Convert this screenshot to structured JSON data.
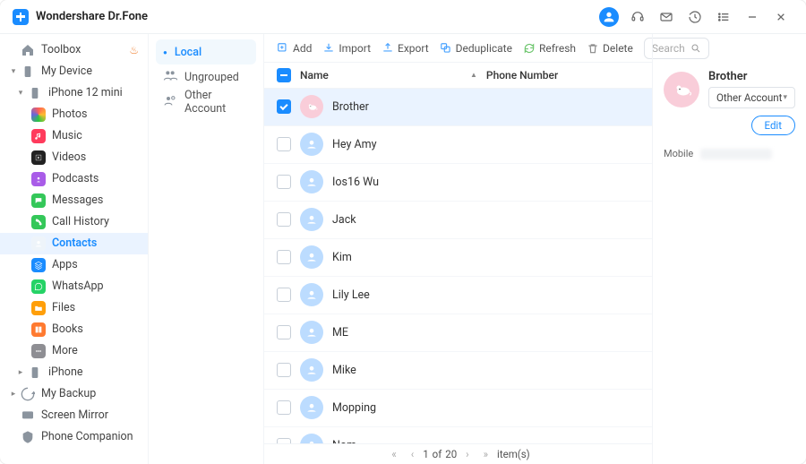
{
  "app": {
    "title": "Wondershare Dr.Fone"
  },
  "sidebar": {
    "toolbox": "Toolbox",
    "my_device": "My Device",
    "device_name": "iPhone 12 mini",
    "items": [
      {
        "label": "Photos"
      },
      {
        "label": "Music"
      },
      {
        "label": "Videos"
      },
      {
        "label": "Podcasts"
      },
      {
        "label": "Messages"
      },
      {
        "label": "Call History"
      },
      {
        "label": "Contacts"
      },
      {
        "label": "Apps"
      },
      {
        "label": "WhatsApp"
      },
      {
        "label": "Files"
      },
      {
        "label": "Books"
      },
      {
        "label": "More"
      }
    ],
    "iphone": "iPhone",
    "my_backup": "My Backup",
    "screen_mirror": "Screen Mirror",
    "phone_companion": "Phone Companion"
  },
  "categories": {
    "local": "Local",
    "ungrouped": "Ungrouped",
    "other_account": "Other Account"
  },
  "toolbar": {
    "add": "Add",
    "import": "Import",
    "export": "Export",
    "deduplicate": "Deduplicate",
    "refresh": "Refresh",
    "delete": "Delete",
    "search_placeholder": "Search"
  },
  "table": {
    "col_name": "Name",
    "col_phone": "Phone Number",
    "rows": [
      {
        "name": "Brother",
        "selected": true,
        "avatar": "pink"
      },
      {
        "name": "Hey  Amy",
        "selected": false,
        "avatar": "blue"
      },
      {
        "name": "Ios16  Wu",
        "selected": false,
        "avatar": "blue"
      },
      {
        "name": "Jack",
        "selected": false,
        "avatar": "blue"
      },
      {
        "name": "Kim",
        "selected": false,
        "avatar": "blue"
      },
      {
        "name": "Lily  Lee",
        "selected": false,
        "avatar": "blue"
      },
      {
        "name": "ME",
        "selected": false,
        "avatar": "blue"
      },
      {
        "name": "Mike",
        "selected": false,
        "avatar": "blue"
      },
      {
        "name": "Mopping",
        "selected": false,
        "avatar": "blue"
      },
      {
        "name": "Nom",
        "selected": false,
        "avatar": "blue"
      }
    ]
  },
  "pager": {
    "current": "1",
    "of": "of",
    "total": "20",
    "items": "item(s)"
  },
  "detail": {
    "name": "Brother",
    "account": "Other Account",
    "edit": "Edit",
    "mobile_label": "Mobile"
  }
}
